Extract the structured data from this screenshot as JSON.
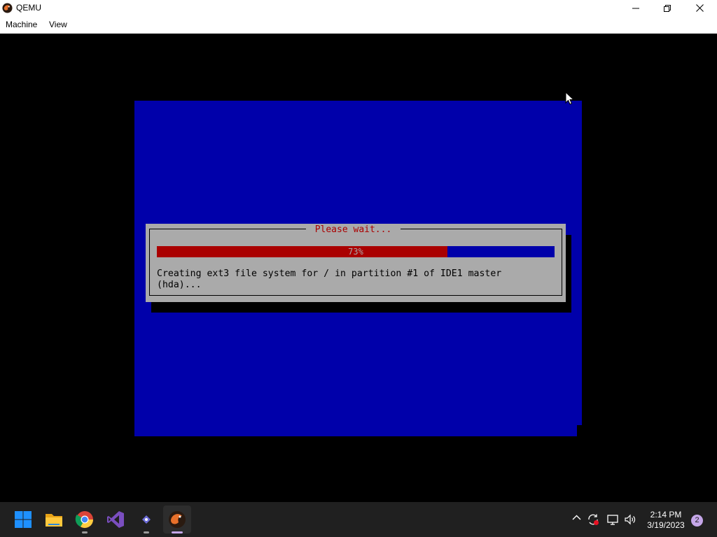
{
  "window": {
    "title": "QEMU",
    "app_icon": "qemu-icon",
    "controls": {
      "minimize": "minimize-icon",
      "restore": "restore-icon",
      "close": "close-icon"
    }
  },
  "menu": {
    "items": [
      {
        "label": "Machine"
      },
      {
        "label": "View"
      }
    ]
  },
  "installer": {
    "dialog_title": "Please wait...",
    "progress_percent": 73,
    "progress_label": "73%",
    "message_line1": "Creating ext3 file system for / in partition #1 of IDE1 master",
    "message_line2": "(hda)...",
    "colors": {
      "background": "#0000aa",
      "dialog": "#aaaaaa",
      "title": "#aa0000",
      "bar_fill": "#aa0000",
      "bar_empty": "#0000aa"
    }
  },
  "taskbar": {
    "apps": [
      {
        "name": "start",
        "icon": "windows-start-icon"
      },
      {
        "name": "file-explorer",
        "icon": "folder-icon"
      },
      {
        "name": "chrome",
        "icon": "chrome-icon"
      },
      {
        "name": "visual-studio",
        "icon": "visual-studio-icon"
      },
      {
        "name": "app",
        "icon": "app-icon"
      },
      {
        "name": "qemu",
        "icon": "qemu-icon"
      }
    ],
    "tray": {
      "icons": [
        "chevron-up-icon",
        "sync-icon",
        "network-icon",
        "volume-icon"
      ],
      "time": "2:14 PM",
      "date": "3/19/2023",
      "notification_count": "2"
    }
  }
}
